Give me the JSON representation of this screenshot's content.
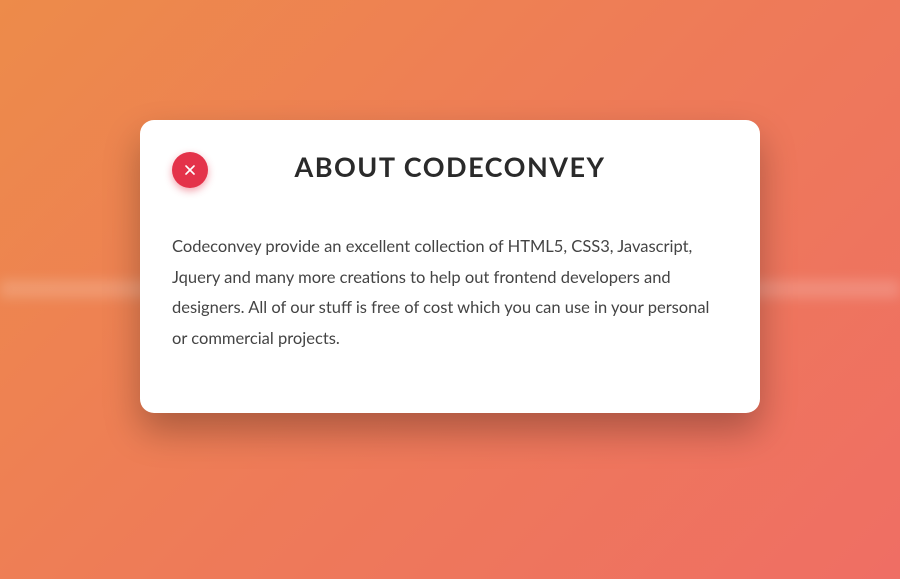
{
  "modal": {
    "title": "ABOUT CODECONVEY",
    "body": "Codeconvey provide an excellent collection of HTML5, CSS3, Javascript, Jquery and many more creations to help out frontend developers and designers. All of our stuff is free of cost which you can use in your personal or commercial projects."
  },
  "colors": {
    "close_button": "#e4334a",
    "background_start": "#ed8b4a",
    "background_end": "#ef6e64"
  }
}
